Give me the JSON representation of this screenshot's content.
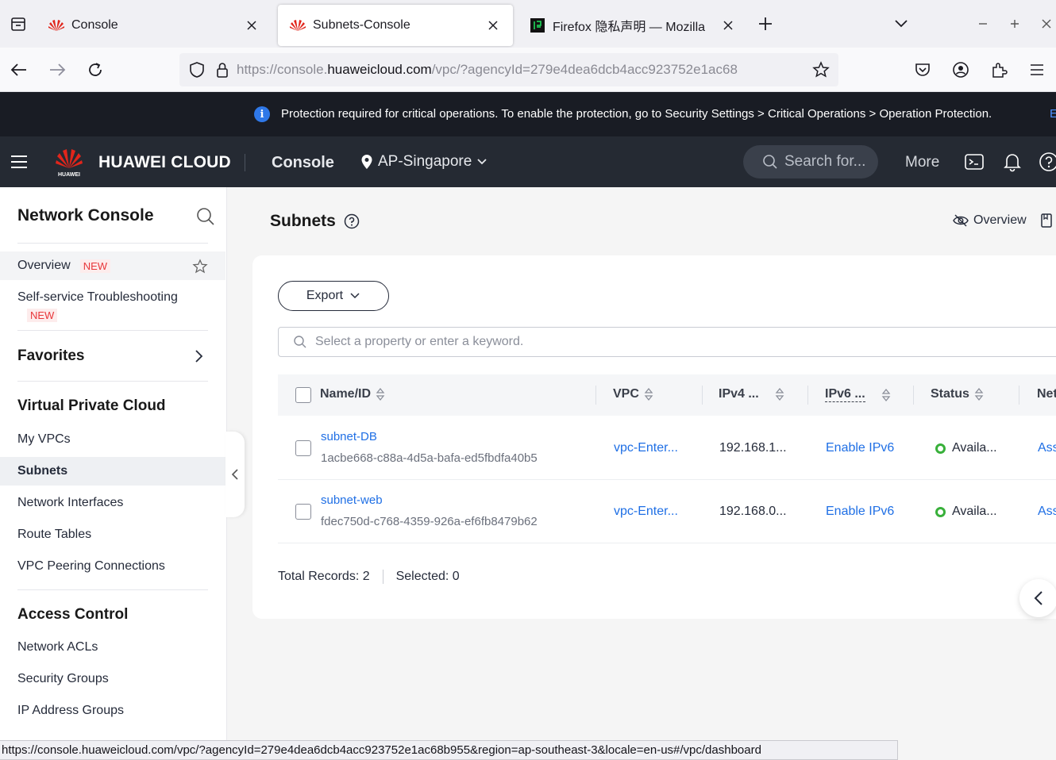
{
  "browser": {
    "tabs": [
      {
        "title": "Console",
        "active": false
      },
      {
        "title": "Subnets-Console",
        "active": true
      },
      {
        "title": "Firefox 隐私声明 — Mozilla",
        "active": false
      }
    ],
    "url_prefix": "https://console.",
    "url_domain": "huaweicloud.com",
    "url_rest": "/vpc/?agencyId=279e4dea6dcb4acc923752e1ac68",
    "status_url": "https://console.huaweicloud.com/vpc/?agencyId=279e4dea6dcb4acc923752e1ac68b955&region=ap-southeast-3&locale=en-us#/vpc/dashboard"
  },
  "banner": {
    "message": "Protection required for critical operations. To enable the protection, go to Security Settings > Critical Operations > Operation Protection.",
    "more": "E"
  },
  "header": {
    "brand": "HUAWEI CLOUD",
    "logo_text": "HUAWEI",
    "console": "Console",
    "region": "AP-Singapore",
    "search_placeholder": "Search for...",
    "more": "More"
  },
  "sidebar": {
    "title": "Network Console",
    "overview": "Overview",
    "new_badge": "NEW",
    "troubleshooting": "Self-service Troubleshooting",
    "favorites": "Favorites",
    "vpc_section": "Virtual Private Cloud",
    "vpc_items": [
      "My VPCs",
      "Subnets",
      "Network Interfaces",
      "Route Tables",
      "VPC Peering Connections"
    ],
    "access_section": "Access Control",
    "access_items": [
      "Network ACLs",
      "Security Groups",
      "IP Address Groups"
    ]
  },
  "main": {
    "title": "Subnets",
    "overview_link": "Overview",
    "export": "Export",
    "filter_placeholder": "Select a property or enter a keyword.",
    "columns": [
      "Name/ID",
      "VPC",
      "IPv4 ...",
      "IPv6 ...",
      "Status",
      "Net"
    ],
    "rows": [
      {
        "name": "subnet-DB",
        "id": "1acbe668-c88a-4d5a-bafa-ed5fbdfa40b5",
        "vpc": "vpc-Enter...",
        "ipv4": "192.168.1...",
        "ipv6": "Enable IPv6",
        "status": "Availa...",
        "net": "Ass"
      },
      {
        "name": "subnet-web",
        "id": "fdec750d-c768-4359-926a-ef6fb8479b62",
        "vpc": "vpc-Enter...",
        "ipv4": "192.168.0...",
        "ipv6": "Enable IPv6",
        "status": "Availa...",
        "net": "Ass"
      }
    ],
    "total_records": "Total Records: 2",
    "selected": "Selected: 0"
  },
  "colors": {
    "link": "#1f6fe5",
    "status_ok": "#38b03a",
    "header_bg": "#252a33",
    "banner_bg": "#191c24"
  }
}
